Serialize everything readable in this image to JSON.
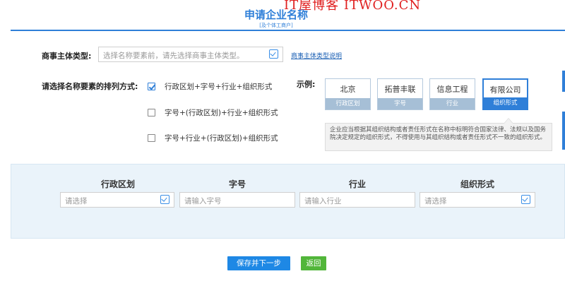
{
  "watermark": "IT屋博客 ITWOO.CN",
  "header": {
    "title": "申请企业名称",
    "subtitle": "[及个体工商户]"
  },
  "entity_type": {
    "label": "商事主体类型:",
    "placeholder": "选择名称要素前，请先选择商事主体类型。",
    "help_link": "商事主体类型说明"
  },
  "order": {
    "label": "请选择名称要素的排列方式:",
    "options": [
      {
        "label": "行政区划+字号+行业+组织形式",
        "checked": true
      },
      {
        "label": "字号+(行政区划)+行业+组织形式",
        "checked": false
      },
      {
        "label": "字号+行业+(行政区划)+组织形式",
        "checked": false
      }
    ]
  },
  "example": {
    "label": "示例:",
    "cards": [
      {
        "text": "北京",
        "tag": "行政区划"
      },
      {
        "text": "拓普丰联",
        "tag": "字号"
      },
      {
        "text": "信息工程",
        "tag": "行业"
      },
      {
        "text": "有限公司",
        "tag": "组织形式",
        "active": true
      }
    ],
    "tooltip": "企业应当根据其组织结构或者责任形式在名称中标明符合国家法律、法规以及国务院决定规定的组织形式，不得使用与其组织结构或者责任形式不一致的组织形式。"
  },
  "fields": [
    {
      "header": "行政区划",
      "placeholder": "请选择",
      "icon": "calendar-check-icon"
    },
    {
      "header": "字号",
      "placeholder": "请输入字号"
    },
    {
      "header": "行业",
      "placeholder": "请输入行业"
    },
    {
      "header": "组织形式",
      "placeholder": "请选择",
      "icon": "calendar-check-icon"
    }
  ],
  "buttons": {
    "save_next": "保存并下一步",
    "back": "返回"
  },
  "colors": {
    "primary": "#2f7fd8",
    "save_button": "#1e88e5",
    "back_button": "#52b63a",
    "panel_bg": "#eaf3fa",
    "watermark": "#e02020"
  }
}
